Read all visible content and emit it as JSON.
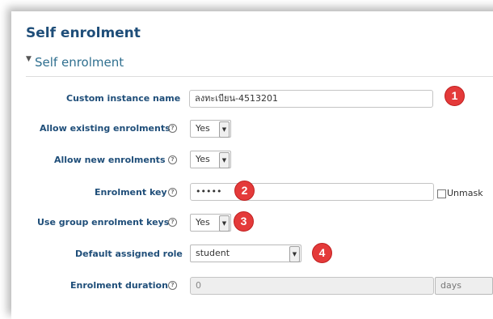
{
  "page": {
    "title": "Self enrolment"
  },
  "section": {
    "title": "Self enrolment",
    "expanded": true
  },
  "help_glyph": "?",
  "fields": {
    "custom_instance_name": {
      "label": "Custom instance name",
      "value": "ลงทะเบียน-4513201"
    },
    "allow_existing": {
      "label": "Allow existing enrolments",
      "value": "Yes"
    },
    "allow_new": {
      "label": "Allow new enrolments",
      "value": "Yes"
    },
    "enrolment_key": {
      "label": "Enrolment key",
      "value": "•••••",
      "unmask_label": "Unmask"
    },
    "use_group_keys": {
      "label": "Use group enrolment keys",
      "value": "Yes"
    },
    "default_role": {
      "label": "Default assigned role",
      "value": "student"
    },
    "enrolment_duration": {
      "label": "Enrolment duration",
      "value": "0",
      "unit": "days"
    }
  },
  "annotations": [
    "1",
    "2",
    "3",
    "4"
  ],
  "colors": {
    "label": "#1f4e79",
    "badge": "#e43a3a",
    "title": "#1f4e79"
  },
  "icons": {
    "help": "help-circle-icon",
    "dropdown": "chevron-down-icon",
    "collapse": "caret-down-icon"
  }
}
